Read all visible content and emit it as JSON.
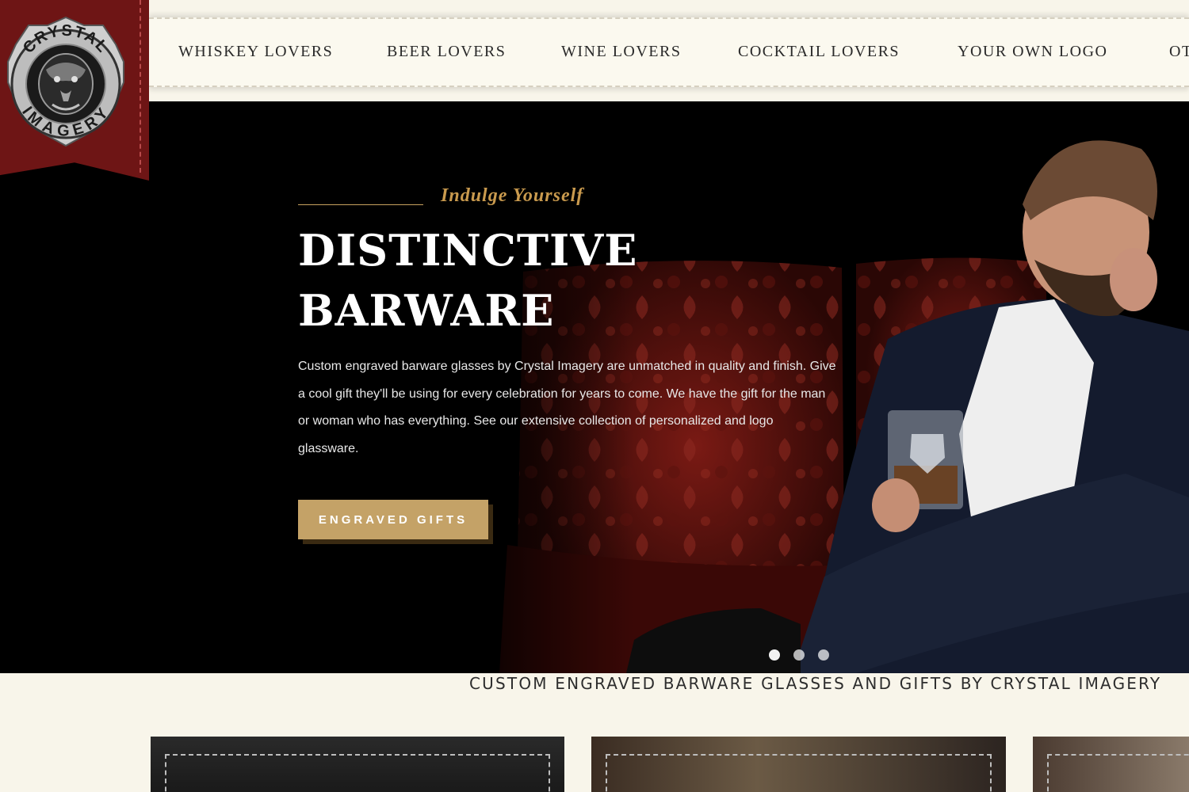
{
  "brand": {
    "logo_text_top": "CRYSTAL",
    "logo_text_bottom": "IMAGERY",
    "banner_color": "#6e1515"
  },
  "nav": {
    "items": [
      {
        "label": "WHISKEY LOVERS"
      },
      {
        "label": "BEER LOVERS"
      },
      {
        "label": "WINE LOVERS"
      },
      {
        "label": "COCKTAIL LOVERS"
      },
      {
        "label": "YOUR OWN LOGO"
      },
      {
        "label": "OT"
      }
    ]
  },
  "hero": {
    "tagline": "Indulge Yourself",
    "headline_line1": "DISTINCTIVE",
    "headline_line2": "BARWARE",
    "description": "Custom engraved barware glasses by Crystal Imagery are unmatched in quality and finish. Give a cool gift they'll be using for every celebration for years to come. We have the gift for the man or woman who has everything. See our extensive collection of personalized and logo glassware.",
    "cta_label": "ENGRAVED GIFTS",
    "cta_color": "#c4a267",
    "accent_color": "#c99a4e",
    "slides_count": 3
  },
  "section": {
    "title": "CUSTOM ENGRAVED BARWARE GLASSES AND GIFTS BY CRYSTAL IMAGERY"
  },
  "icons": {
    "logo": "crystal-imagery-lion-crest",
    "slider_dot": "circle"
  }
}
